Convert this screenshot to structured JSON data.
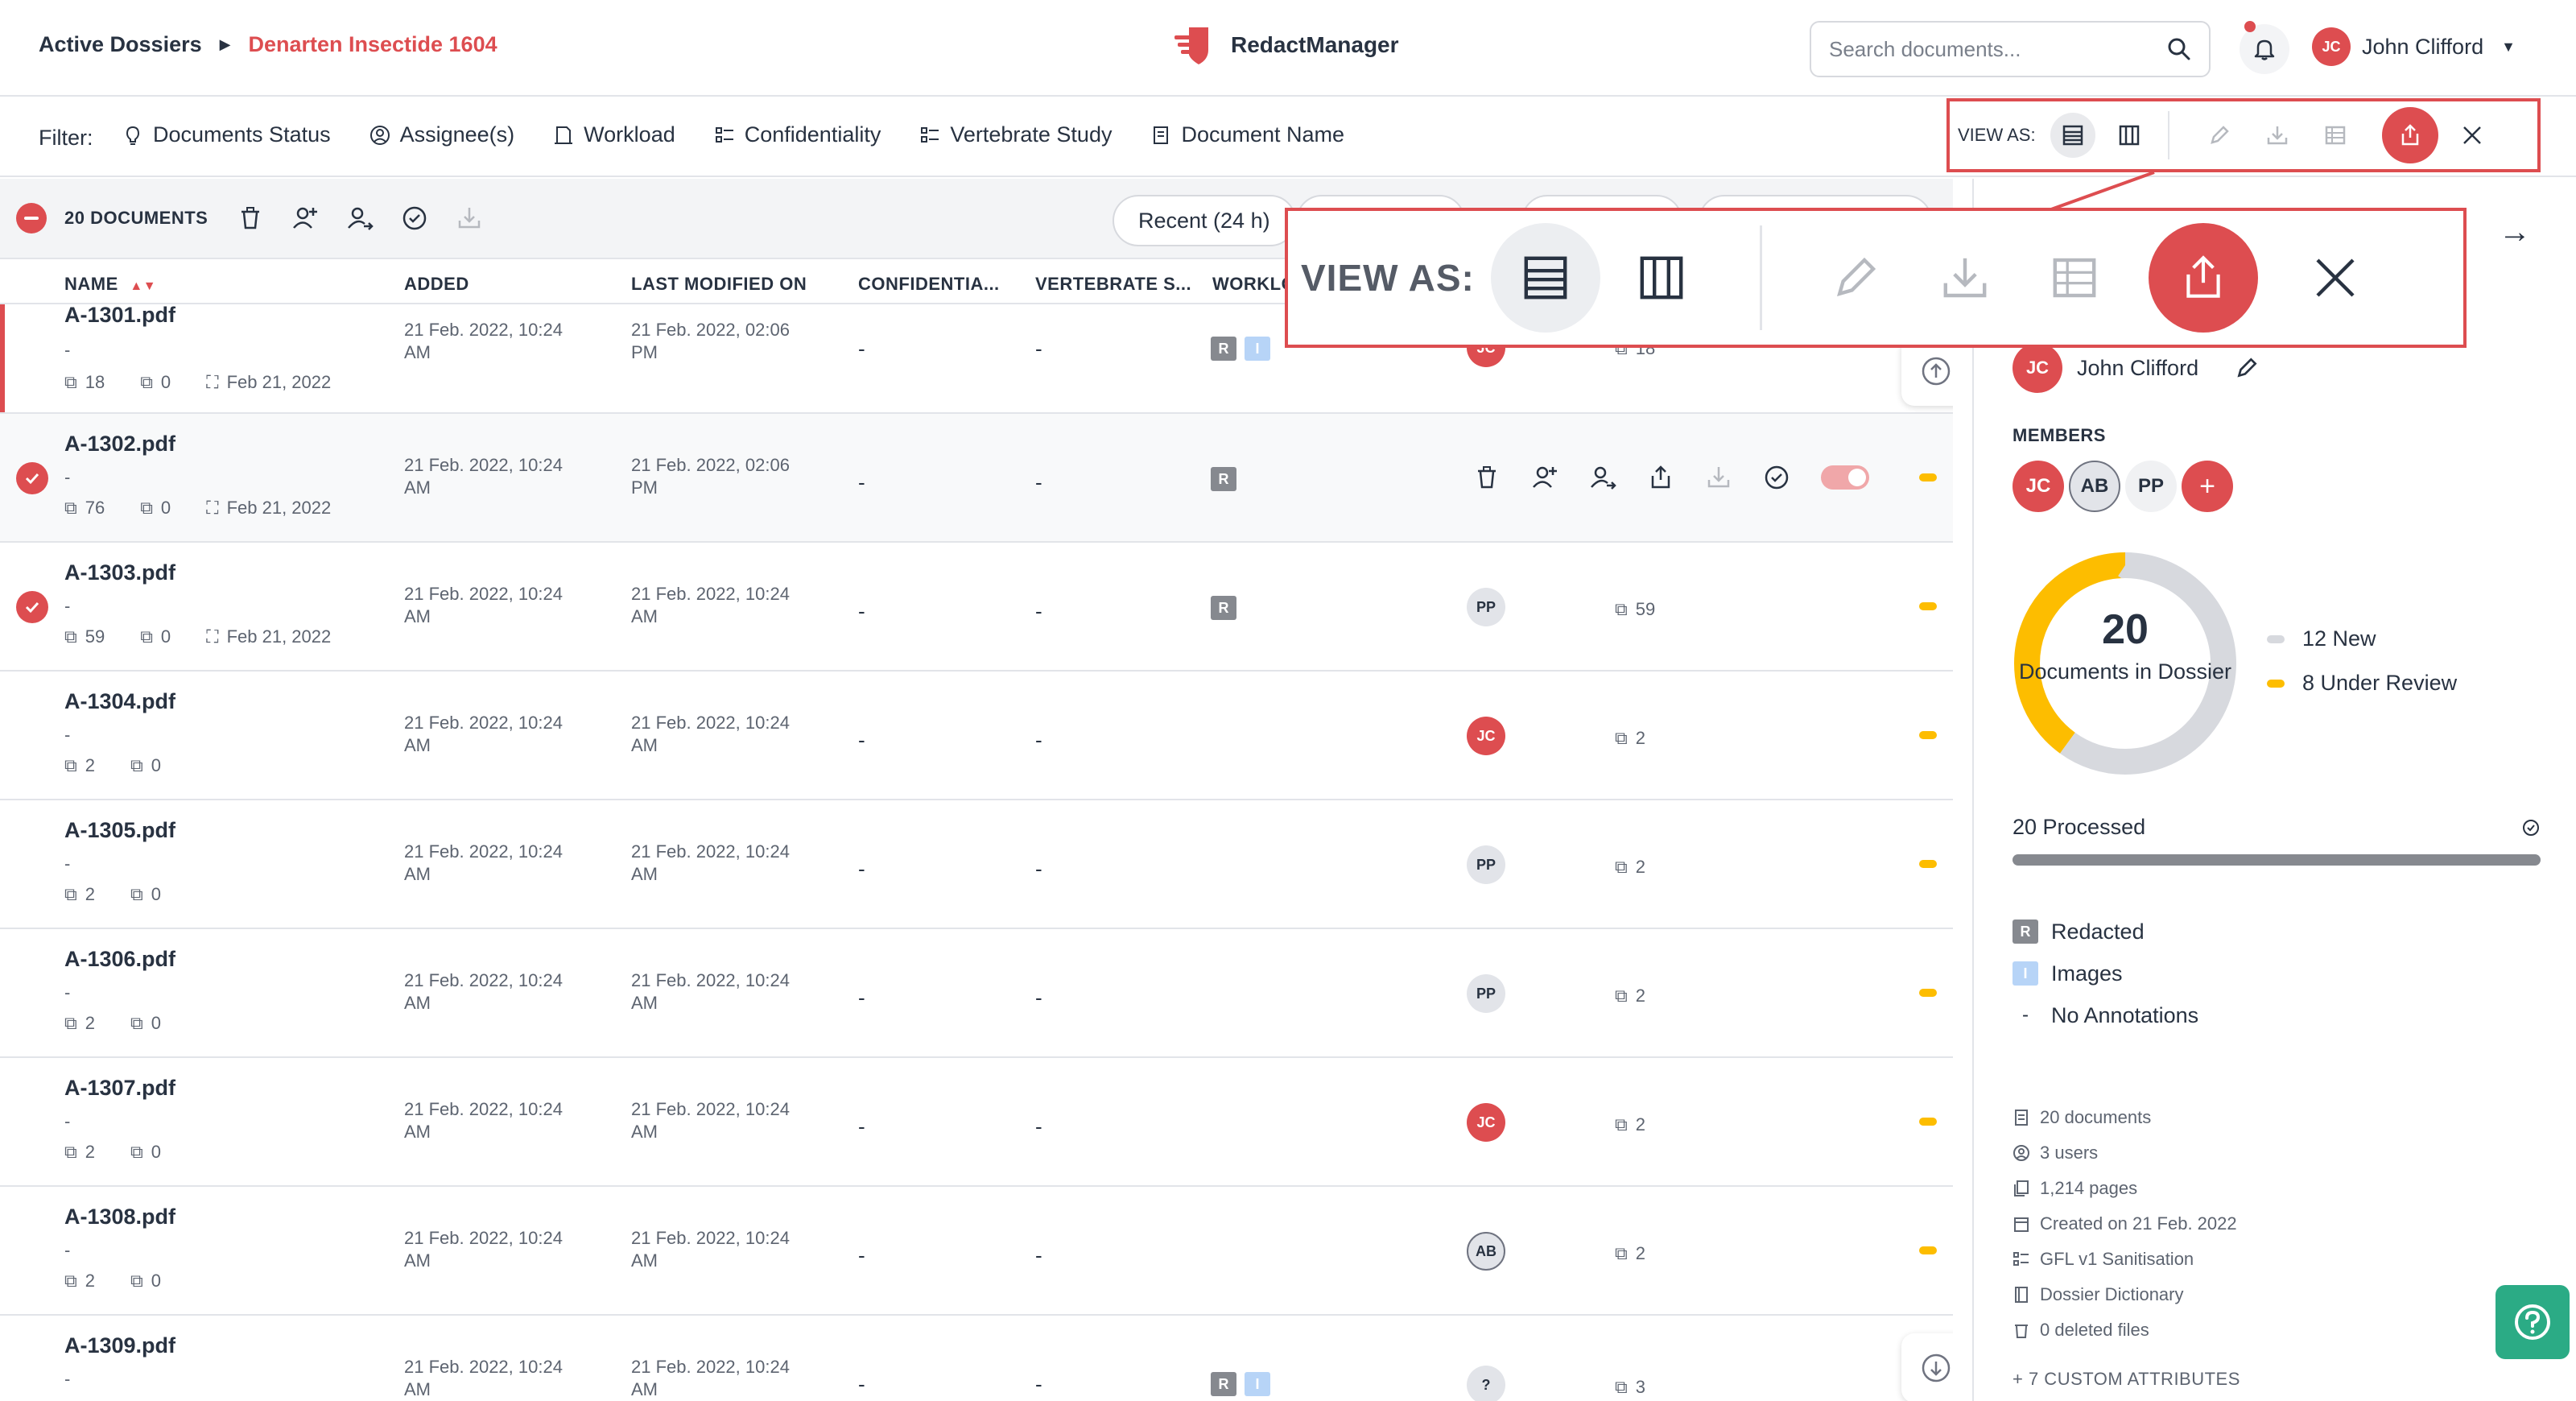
{
  "breadcrumb": {
    "root": "Active Dossiers",
    "current": "Denarten Insectide 1604"
  },
  "brand": {
    "name": "RedactManager"
  },
  "search": {
    "placeholder": "Search documents..."
  },
  "user": {
    "initials": "JC",
    "name": "John Clifford"
  },
  "filter": {
    "label": "Filter:",
    "items": [
      "Documents Status",
      "Assignee(s)",
      "Workload",
      "Confidentiality",
      "Vertebrate Study",
      "Document Name"
    ]
  },
  "view_as": {
    "label": "VIEW AS:"
  },
  "actionbar": {
    "count": "20 DOCUMENTS",
    "recent": "Recent (24 h)"
  },
  "columns": {
    "name": "NAME",
    "added": "ADDED",
    "modified": "LAST MODIFIED ON",
    "confidentiality": "CONFIDENTIA...",
    "vertebrate": "VERTEBRATE S...",
    "workload": "WORKLO"
  },
  "rows": [
    {
      "name": "A-1301.pdf",
      "dash": "-",
      "pages": "18",
      "files": "0",
      "date": "Feb 21, 2022",
      "added": "21 Feb. 2022, 10:24 AM",
      "modified": "21 Feb. 2022, 02:06 PM",
      "conf": "-",
      "vert": "-",
      "assignee": "JC",
      "pagecount": "18"
    },
    {
      "name": "A-1302.pdf",
      "dash": "-",
      "pages": "76",
      "files": "0",
      "date": "Feb 21, 2022",
      "added": "21 Feb. 2022, 10:24 AM",
      "modified": "21 Feb. 2022, 02:06 PM",
      "conf": "-",
      "vert": "-"
    },
    {
      "name": "A-1303.pdf",
      "dash": "-",
      "pages": "59",
      "files": "0",
      "date": "Feb 21, 2022",
      "added": "21 Feb. 2022, 10:24 AM",
      "modified": "21 Feb. 2022, 10:24 AM",
      "conf": "-",
      "vert": "-",
      "assignee": "PP",
      "pagecount": "59"
    },
    {
      "name": "A-1304.pdf",
      "dash": "-",
      "pages": "2",
      "files": "0",
      "added": "21 Feb. 2022, 10:24 AM",
      "modified": "21 Feb. 2022, 10:24 AM",
      "conf": "-",
      "vert": "-",
      "assignee": "JC",
      "pagecount": "2"
    },
    {
      "name": "A-1305.pdf",
      "dash": "-",
      "pages": "2",
      "files": "0",
      "added": "21 Feb. 2022, 10:24 AM",
      "modified": "21 Feb. 2022, 10:24 AM",
      "conf": "-",
      "vert": "-",
      "assignee": "PP",
      "pagecount": "2"
    },
    {
      "name": "A-1306.pdf",
      "dash": "-",
      "pages": "2",
      "files": "0",
      "added": "21 Feb. 2022, 10:24 AM",
      "modified": "21 Feb. 2022, 10:24 AM",
      "conf": "-",
      "vert": "-",
      "assignee": "PP",
      "pagecount": "2"
    },
    {
      "name": "A-1307.pdf",
      "dash": "-",
      "pages": "2",
      "files": "0",
      "added": "21 Feb. 2022, 10:24 AM",
      "modified": "21 Feb. 2022, 10:24 AM",
      "conf": "-",
      "vert": "-",
      "assignee": "JC",
      "pagecount": "2"
    },
    {
      "name": "A-1308.pdf",
      "dash": "-",
      "pages": "2",
      "files": "0",
      "added": "21 Feb. 2022, 10:24 AM",
      "modified": "21 Feb. 2022, 10:24 AM",
      "conf": "-",
      "vert": "-",
      "assignee": "AB",
      "pagecount": "2"
    },
    {
      "name": "A-1309.pdf",
      "dash": "-",
      "added": "21 Feb. 2022, 10:24 AM",
      "modified": "21 Feb. 2022, 10:24 AM",
      "conf": "-",
      "vert": "-",
      "assignee": "?",
      "pagecount": "3"
    }
  ],
  "badges": {
    "redacted": "R",
    "images": "I"
  },
  "dossier": {
    "owner": "John Clifford",
    "owner_initials": "JC",
    "members_label": "MEMBERS",
    "members": [
      "JC",
      "AB",
      "PP"
    ],
    "add_member": "+",
    "total": "20",
    "total_label": "Documents in Dossier",
    "legend": [
      {
        "label": "12 New",
        "value": 12,
        "color": "#d7d9de"
      },
      {
        "label": "8 Under Review",
        "value": 8,
        "color": "#fdbd00"
      }
    ],
    "processed": "20 Processed",
    "processed_fraction": 1.0,
    "annotations": [
      {
        "badge": "R",
        "label": "Redacted"
      },
      {
        "badge": "I",
        "label": "Images"
      },
      {
        "badge": "-",
        "label": "No Annotations"
      }
    ],
    "details": [
      "20 documents",
      "3 users",
      "1,214 pages",
      "Created on 21 Feb. 2022",
      "GFL v1 Sanitisation",
      "Dossier Dictionary",
      "0 deleted files"
    ],
    "custom_attributes": "+ 7 CUSTOM ATTRIBUTES"
  },
  "colors": {
    "accent": "#dd4d50",
    "warning": "#fdbd00",
    "success": "#2bab85"
  }
}
